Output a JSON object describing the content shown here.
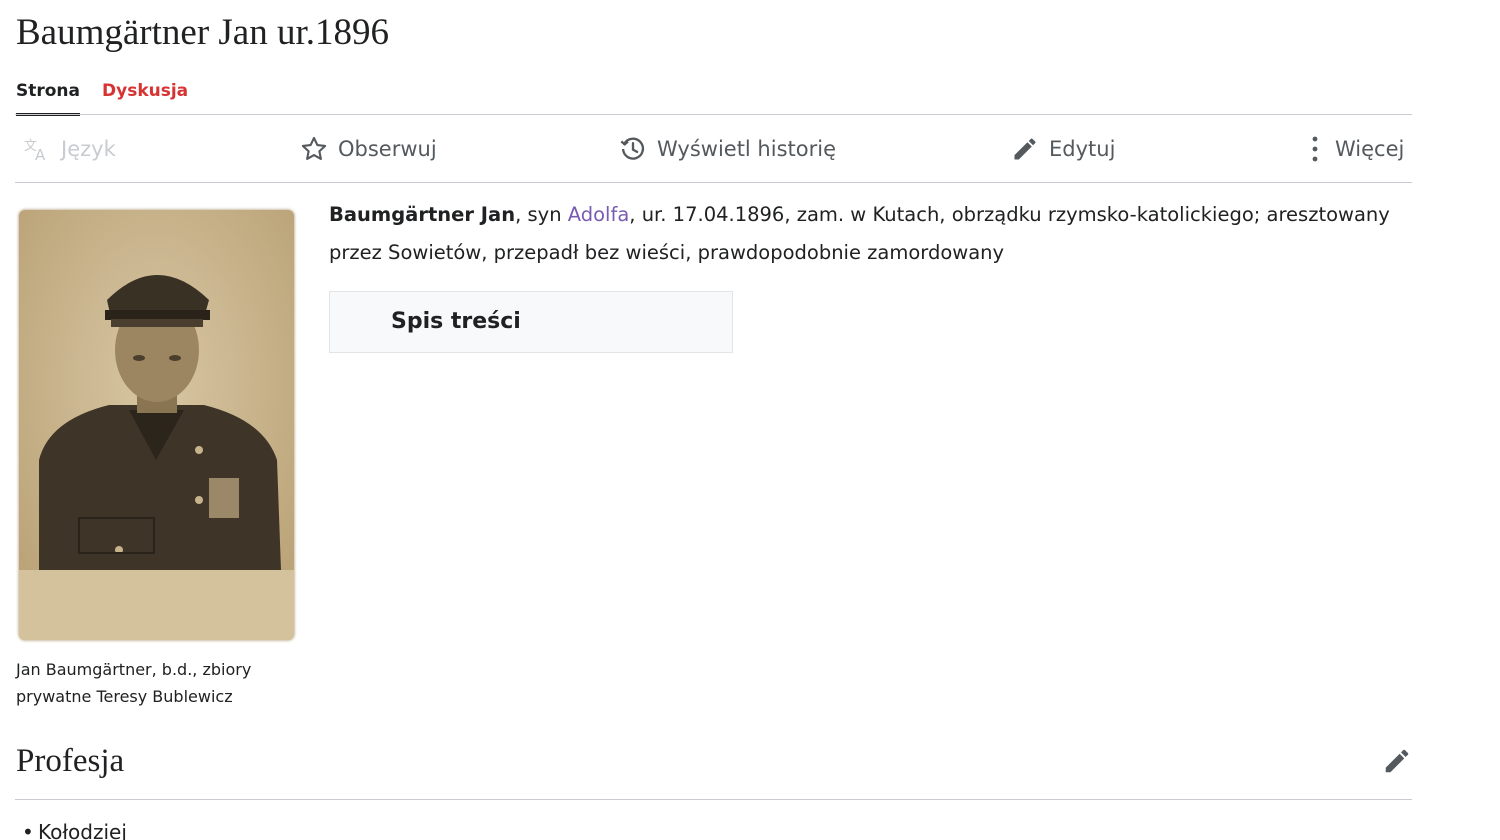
{
  "page": {
    "title": "Baumgärtner Jan ur.1896"
  },
  "namespace_tabs": [
    {
      "label": "Strona",
      "state": "active"
    },
    {
      "label": "Dyskusja",
      "state": "new"
    }
  ],
  "actions": {
    "language": {
      "label": "Język",
      "icon": "translate-icon"
    },
    "watch": {
      "label": "Obserwuj",
      "icon": "star-icon"
    },
    "history": {
      "label": "Wyświetl historię",
      "icon": "history-icon"
    },
    "edit": {
      "label": "Edytuj",
      "icon": "pencil-icon"
    },
    "more": {
      "label": "Więcej",
      "icon": "vertical-ellipsis-icon"
    }
  },
  "lead": {
    "name_bold": "Baumgärtner Jan",
    "text_before_link": ", syn ",
    "father_link": "Adolfa",
    "text_after_link": ", ur. 17.04.1896, zam. w Kutach, obrządku rzymsko-katolickiego; aresztowany przez Sowietów, przepadł bez wieści, prawdopodobnie zamordowany"
  },
  "toc": {
    "title": "Spis treści"
  },
  "image": {
    "caption": "Jan Baumgärtner, b.d., zbiory prywatne Teresy Bublewicz"
  },
  "section": {
    "heading": "Profesja",
    "items": [
      "Kołodziej"
    ]
  },
  "colors": {
    "text": "#202122",
    "link_visited": "#795cb2",
    "link_new": "#d73333",
    "icon": "#54595d",
    "disabled": "#c8ccd1",
    "divider": "#c8ccd1"
  }
}
